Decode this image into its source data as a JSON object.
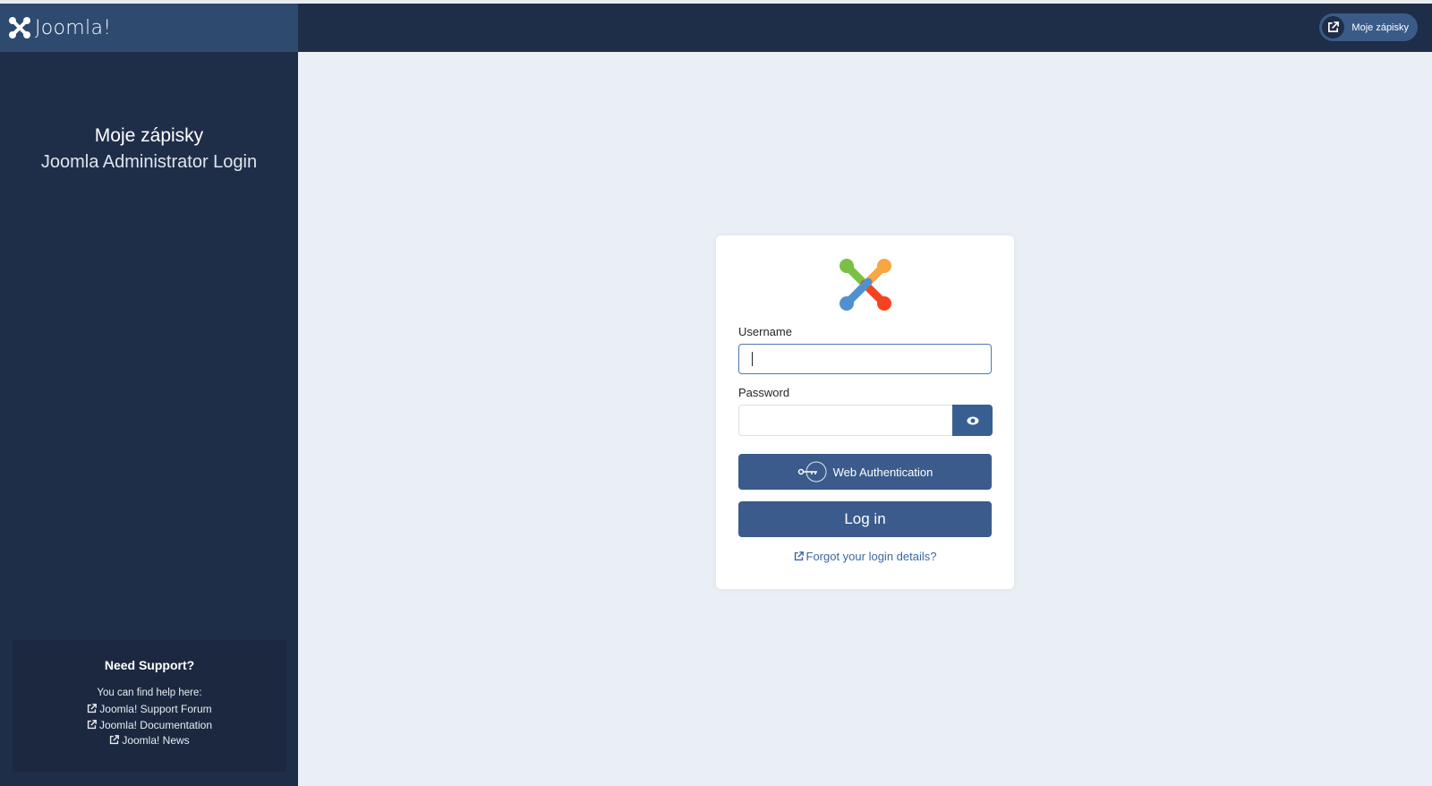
{
  "header": {
    "brand": "Joomla!",
    "site_link_label": "Moje zápisky",
    "site_link_icon": "external-link-icon"
  },
  "sidebar": {
    "site_name": "Moje zápisky",
    "subtitle": "Joomla Administrator Login",
    "support": {
      "title": "Need Support?",
      "help_text": "You can find help here:",
      "links": [
        {
          "label": "Joomla! Support Forum",
          "icon": "external-link-icon"
        },
        {
          "label": "Joomla! Documentation",
          "icon": "external-link-icon"
        },
        {
          "label": "Joomla! News",
          "icon": "external-link-icon"
        }
      ]
    }
  },
  "login": {
    "username_label": "Username",
    "username_value": "",
    "password_label": "Password",
    "password_value": "",
    "show_password_icon": "eye-icon",
    "webauthn_label": "Web Authentication",
    "webauthn_icon": "passkey-icon",
    "login_label": "Log in",
    "forgot_label": "Forgot your login details?"
  },
  "colors": {
    "header_bg": "#1f2e48",
    "logo_bg": "#2e4a6f",
    "primary_button": "#3a5b8c",
    "link": "#3a68a3",
    "page_bg": "#eaeff5"
  }
}
